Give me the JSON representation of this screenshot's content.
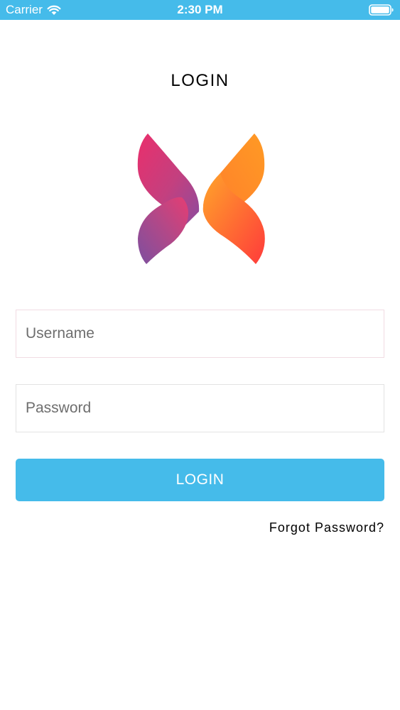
{
  "status_bar": {
    "carrier": "Carrier",
    "time": "2:30 PM",
    "background_color": "#45bbea",
    "wifi_icon": "wifi-icon",
    "battery_icon": "battery-full-icon"
  },
  "login_screen": {
    "title": "LOGIN",
    "logo": "brand-logo",
    "username": {
      "value": "",
      "placeholder": "Username"
    },
    "password": {
      "value": "",
      "placeholder": "Password"
    },
    "login_button_label": "LOGIN",
    "forgot_password_label": "Forgot Password?"
  },
  "colors": {
    "accent": "#45bbea",
    "logo_left_start": "#e8336b",
    "logo_left_end": "#7f4e9e",
    "logo_right_start": "#ffa227",
    "logo_right_end": "#ff3a3a"
  }
}
